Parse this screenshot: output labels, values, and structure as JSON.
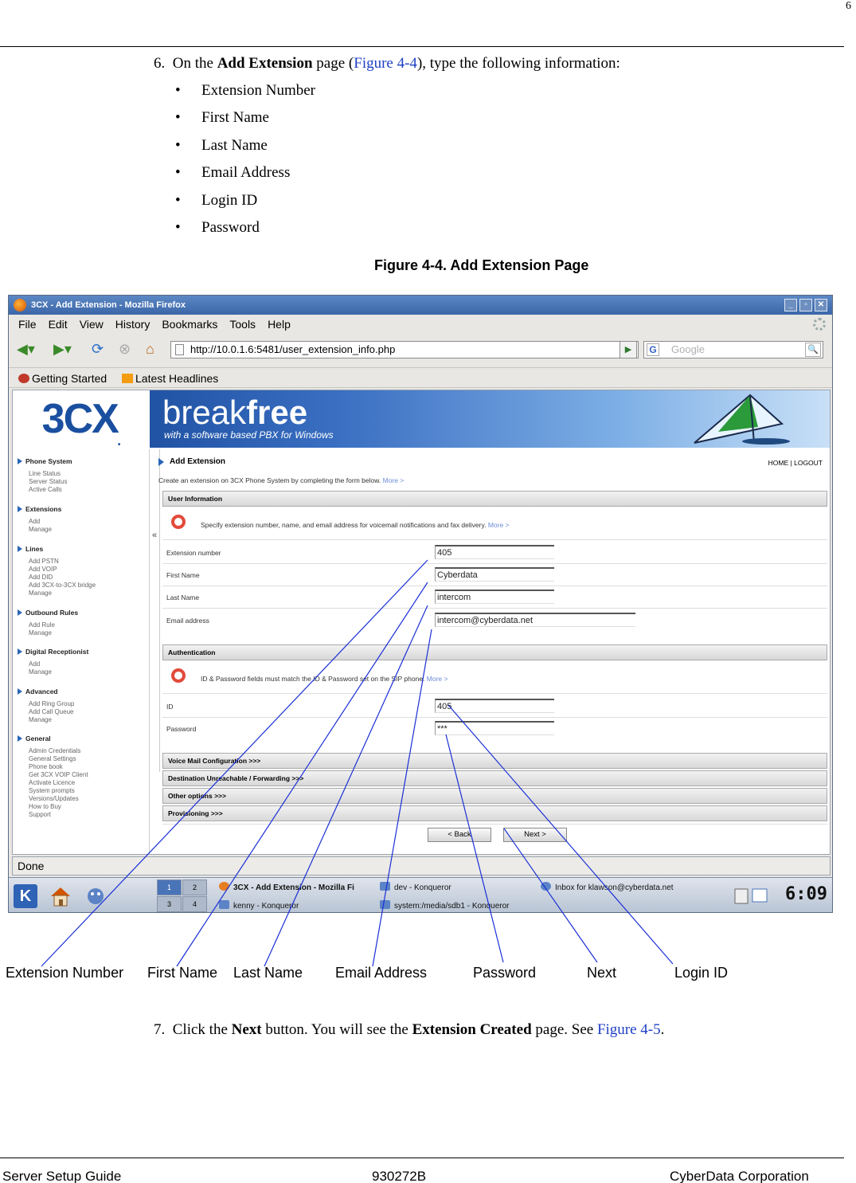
{
  "page_number": "6",
  "step6": {
    "num": "6.",
    "pre": "On the ",
    "bold": "Add Extension",
    "mid": " page (",
    "link": "Figure 4-4",
    "post": "), type the following information:"
  },
  "bullets": [
    "Extension Number",
    "First Name",
    "Last Name",
    "Email Address",
    "Login ID",
    "Password"
  ],
  "figure_caption": "Figure 4-4. Add Extension Page",
  "browser": {
    "title": "3CX - Add Extension - Mozilla Firefox",
    "window_buttons": [
      "_",
      "▫",
      "✕"
    ],
    "menu": [
      "File",
      "Edit",
      "View",
      "History",
      "Bookmarks",
      "Tools",
      "Help"
    ],
    "url": "http://10.0.1.6:5481/user_extension_info.php",
    "search_placeholder": "Google",
    "bookmarks": [
      "Getting Started",
      "Latest Headlines"
    ],
    "status": "Done"
  },
  "banner": {
    "logo": "3CX",
    "brand_pre": "break",
    "brand_bold": "free",
    "tagline": "with a software based PBX for Windows"
  },
  "sidebar": [
    {
      "title": "Phone System",
      "items": [
        "Line Status",
        "Server Status",
        "Active Calls"
      ]
    },
    {
      "title": "Extensions",
      "items": [
        "Add",
        "Manage"
      ]
    },
    {
      "title": "Lines",
      "items": [
        "Add PSTN",
        "Add VOIP",
        "Add DID",
        "Add 3CX-to-3CX bridge",
        "Manage"
      ]
    },
    {
      "title": "Outbound Rules",
      "items": [
        "Add Rule",
        "Manage"
      ]
    },
    {
      "title": "Digital Receptionist",
      "items": [
        "Add",
        "Manage"
      ]
    },
    {
      "title": "Advanced",
      "items": [
        "Add Ring Group",
        "Add Call Queue",
        "Manage"
      ]
    },
    {
      "title": "General",
      "items": [
        "Admin Credentials",
        "General Settings",
        "Phone book",
        "Get 3CX VOIP Client",
        "Activate Licence",
        "System prompts",
        "Versions/Updates",
        "How to Buy",
        "Support"
      ]
    }
  ],
  "collapse_glyph": "«",
  "form": {
    "page_title": "Add Extension",
    "home_logout": "HOME | LOGOUT",
    "intro": "Create an extension on 3CX Phone System by completing the form below. ",
    "more": "More >",
    "user_info_header": "User Information",
    "user_info_text": "Specify extension number, name, and email address for voicemail notifications and fax delivery. ",
    "auth_header": "Authentication",
    "auth_text": "ID & Password fields must match the ID & Password set on the SIP phone. ",
    "fields": {
      "extension_label": "Extension number",
      "extension_value": "405",
      "first_label": "First Name",
      "first_value": "Cyberdata",
      "last_label": "Last Name",
      "last_value": "intercom",
      "email_label": "Email address",
      "email_value": "intercom@cyberdata.net",
      "id_label": "ID",
      "id_value": "405",
      "password_label": "Password",
      "password_value": "***"
    },
    "collapsed_sections": [
      "Voice Mail Configuration >>>",
      "Destination Unreachable / Forwarding >>>",
      "Other options >>>",
      "Provisioning >>>"
    ],
    "back_button": "< Back",
    "next_button": "Next >"
  },
  "taskbar": {
    "k_menu": "K",
    "pager": [
      "1",
      "2",
      "3",
      "4"
    ],
    "tasks": [
      "3CX - Add Extension - Mozilla Fi",
      "dev - Konqueror",
      "Inbox for klawson@cyberdata.net",
      "kenny - Konqueror",
      "system:/media/sdb1 - Konqueror"
    ],
    "clock": "6:09"
  },
  "callout_labels": [
    "Extension Number",
    "First Name",
    "Last Name",
    "Email Address",
    "Password",
    "Next",
    "Login ID"
  ],
  "step7": {
    "num": "7.",
    "pre": "Click the ",
    "bold1": "Next",
    "mid": " button. You will see the ",
    "bold2": "Extension Created",
    "mid2": " page. See ",
    "link": "Figure 4-5",
    "post": "."
  },
  "footer": {
    "left": "Server Setup Guide",
    "center": "930272B",
    "right": "CyberData Corporation"
  },
  "colors": {
    "link": "#1f3fc4",
    "callout_line": "#1a2fd6",
    "brand_blue": "#1a4fa0"
  }
}
